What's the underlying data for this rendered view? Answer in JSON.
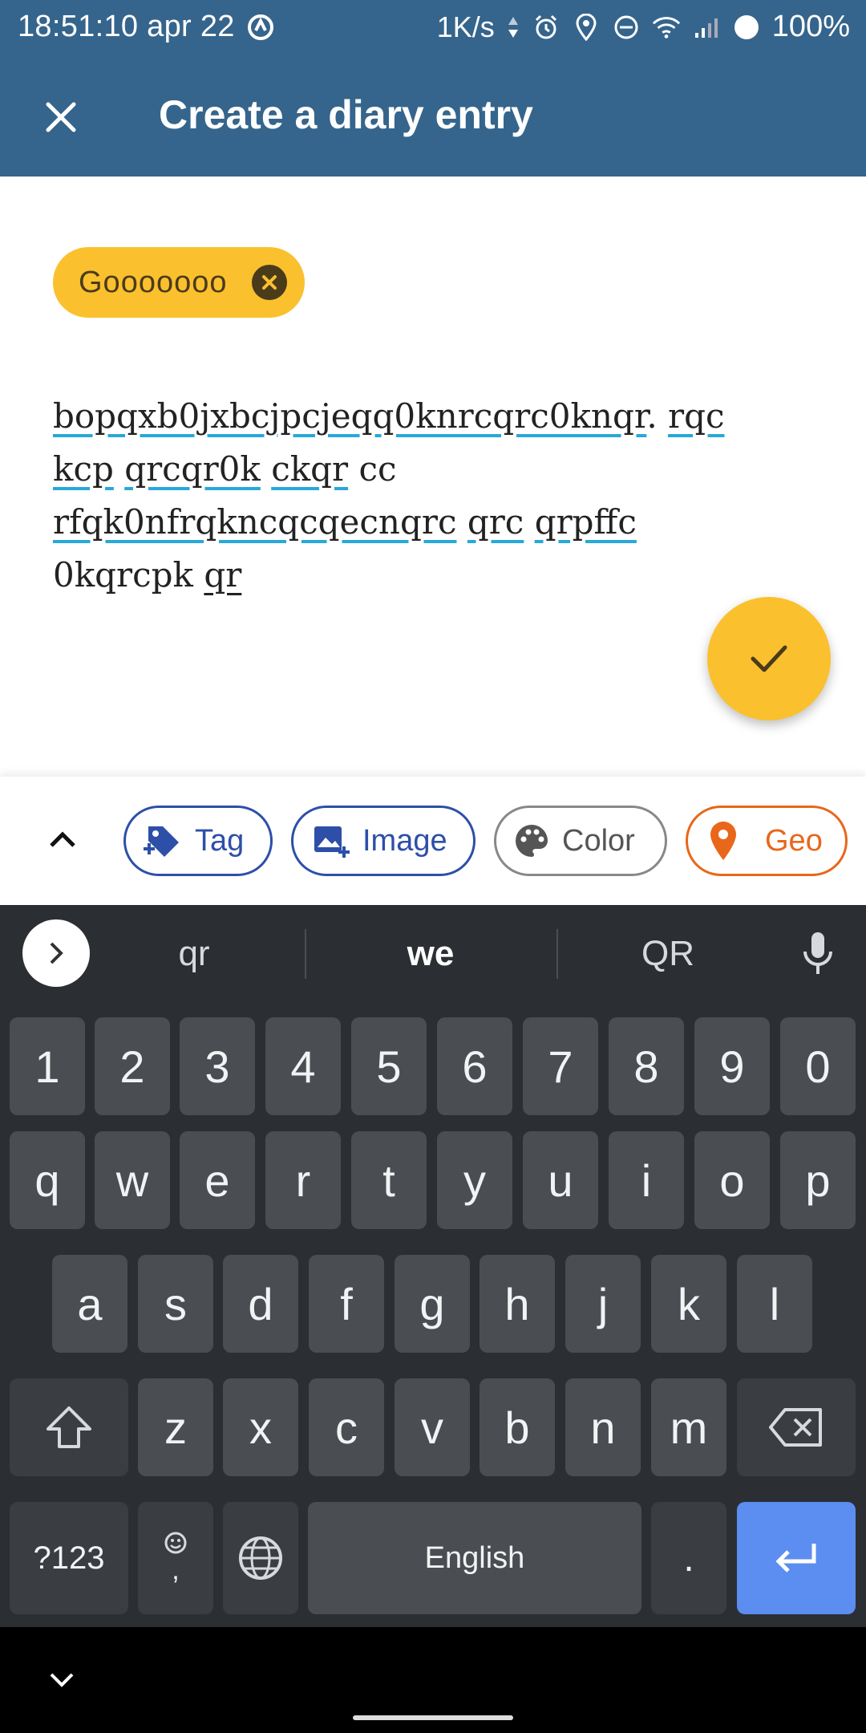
{
  "status_bar": {
    "time": "18:51:10 apr 22",
    "network_speed": "1K/s",
    "battery": "100%",
    "icons": [
      "app-notification-icon",
      "data-arrows-icon",
      "alarm-icon",
      "location-icon",
      "do-not-disturb-icon",
      "wifi-icon",
      "signal-icon",
      "battery-icon"
    ]
  },
  "app_bar": {
    "title": "Create a diary entry",
    "close_icon": "close-icon"
  },
  "tag_chip": {
    "label": "Gooooooo"
  },
  "entry": {
    "text_segments": [
      "bopqxb0jxbcjpcjeqq0knrcqrc0knqr",
      ". ",
      "rqc",
      "kcp",
      "qrcqr0k",
      "ckqr",
      "cc",
      "rfqk0nfrqkncqcqecnqrc",
      "qrc",
      "qrpffc",
      "0kqrcpk",
      "qr"
    ]
  },
  "toolbar": {
    "tag_label": "Tag",
    "image_label": "Image",
    "color_label": "Color",
    "geo_label": "Geo"
  },
  "keyboard": {
    "suggestions": [
      "qr",
      "we",
      "QR"
    ],
    "row_numbers": [
      "1",
      "2",
      "3",
      "4",
      "5",
      "6",
      "7",
      "8",
      "9",
      "0"
    ],
    "row_q": [
      "q",
      "w",
      "e",
      "r",
      "t",
      "y",
      "u",
      "i",
      "o",
      "p"
    ],
    "row_a": [
      "a",
      "s",
      "d",
      "f",
      "g",
      "h",
      "j",
      "k",
      "l"
    ],
    "row_z": [
      "z",
      "x",
      "c",
      "v",
      "b",
      "n",
      "m"
    ],
    "symbols_label": "?123",
    "comma_label": ",",
    "space_label": "English",
    "period_label": "."
  },
  "colors": {
    "app_bar": "#35658C",
    "accent": "#FBC02D",
    "tag_chip_blue": "#2d4fa8",
    "geo_orange": "#E8671B",
    "keyboard_bg": "#2b2f33",
    "enter_key": "#5b8ef0"
  }
}
